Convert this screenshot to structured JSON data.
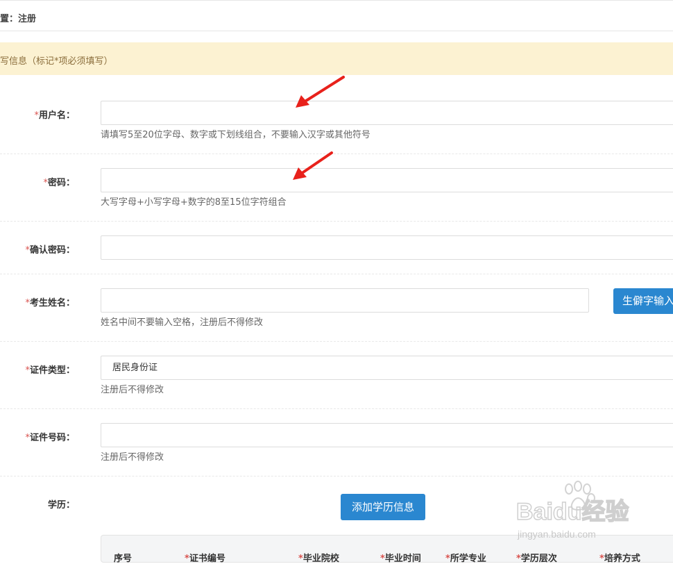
{
  "breadcrumb": "置：注册",
  "notice": "写信息（标记*项必须填写）",
  "fields": {
    "username": {
      "req": "*",
      "label": "用户名：",
      "hint": "请填写5至20位字母、数字或下划线组合，不要输入汉字或其他符号",
      "value": ""
    },
    "password": {
      "req": "*",
      "label": "密码：",
      "hint": "大写字母+小写字母+数字的8至15位字符组合",
      "value": ""
    },
    "confirm_password": {
      "req": "*",
      "label": "确认密码：",
      "value": ""
    },
    "name": {
      "req": "*",
      "label": "考生姓名：",
      "hint": "姓名中间不要输入空格，注册后不得修改",
      "value": "",
      "rare_char_button": "生僻字输入"
    },
    "id_type": {
      "req": "*",
      "label": "证件类型：",
      "value": "居民身份证",
      "hint": "注册后不得修改"
    },
    "id_number": {
      "req": "*",
      "label": "证件号码：",
      "hint": "注册后不得修改",
      "value": ""
    },
    "education": {
      "label": "学历：",
      "add_button": "添加学历信息"
    }
  },
  "education_table": {
    "columns": [
      {
        "req": "",
        "label": "序号"
      },
      {
        "req": "*",
        "label": "证书编号"
      },
      {
        "req": "*",
        "label": "毕业院校"
      },
      {
        "req": "*",
        "label": "毕业时间"
      },
      {
        "req": "*",
        "label": "所学专业"
      },
      {
        "req": "*",
        "label": "学历层次"
      },
      {
        "req": "*",
        "label": "培养方式"
      }
    ]
  },
  "watermark": {
    "brand": "Baidu经验",
    "url": "jingyan.baidu.com"
  },
  "colors": {
    "primary": "#2a87d0",
    "required": "#d9534f",
    "notice_bg": "#fcf2d2",
    "arrow": "#e8211b"
  }
}
